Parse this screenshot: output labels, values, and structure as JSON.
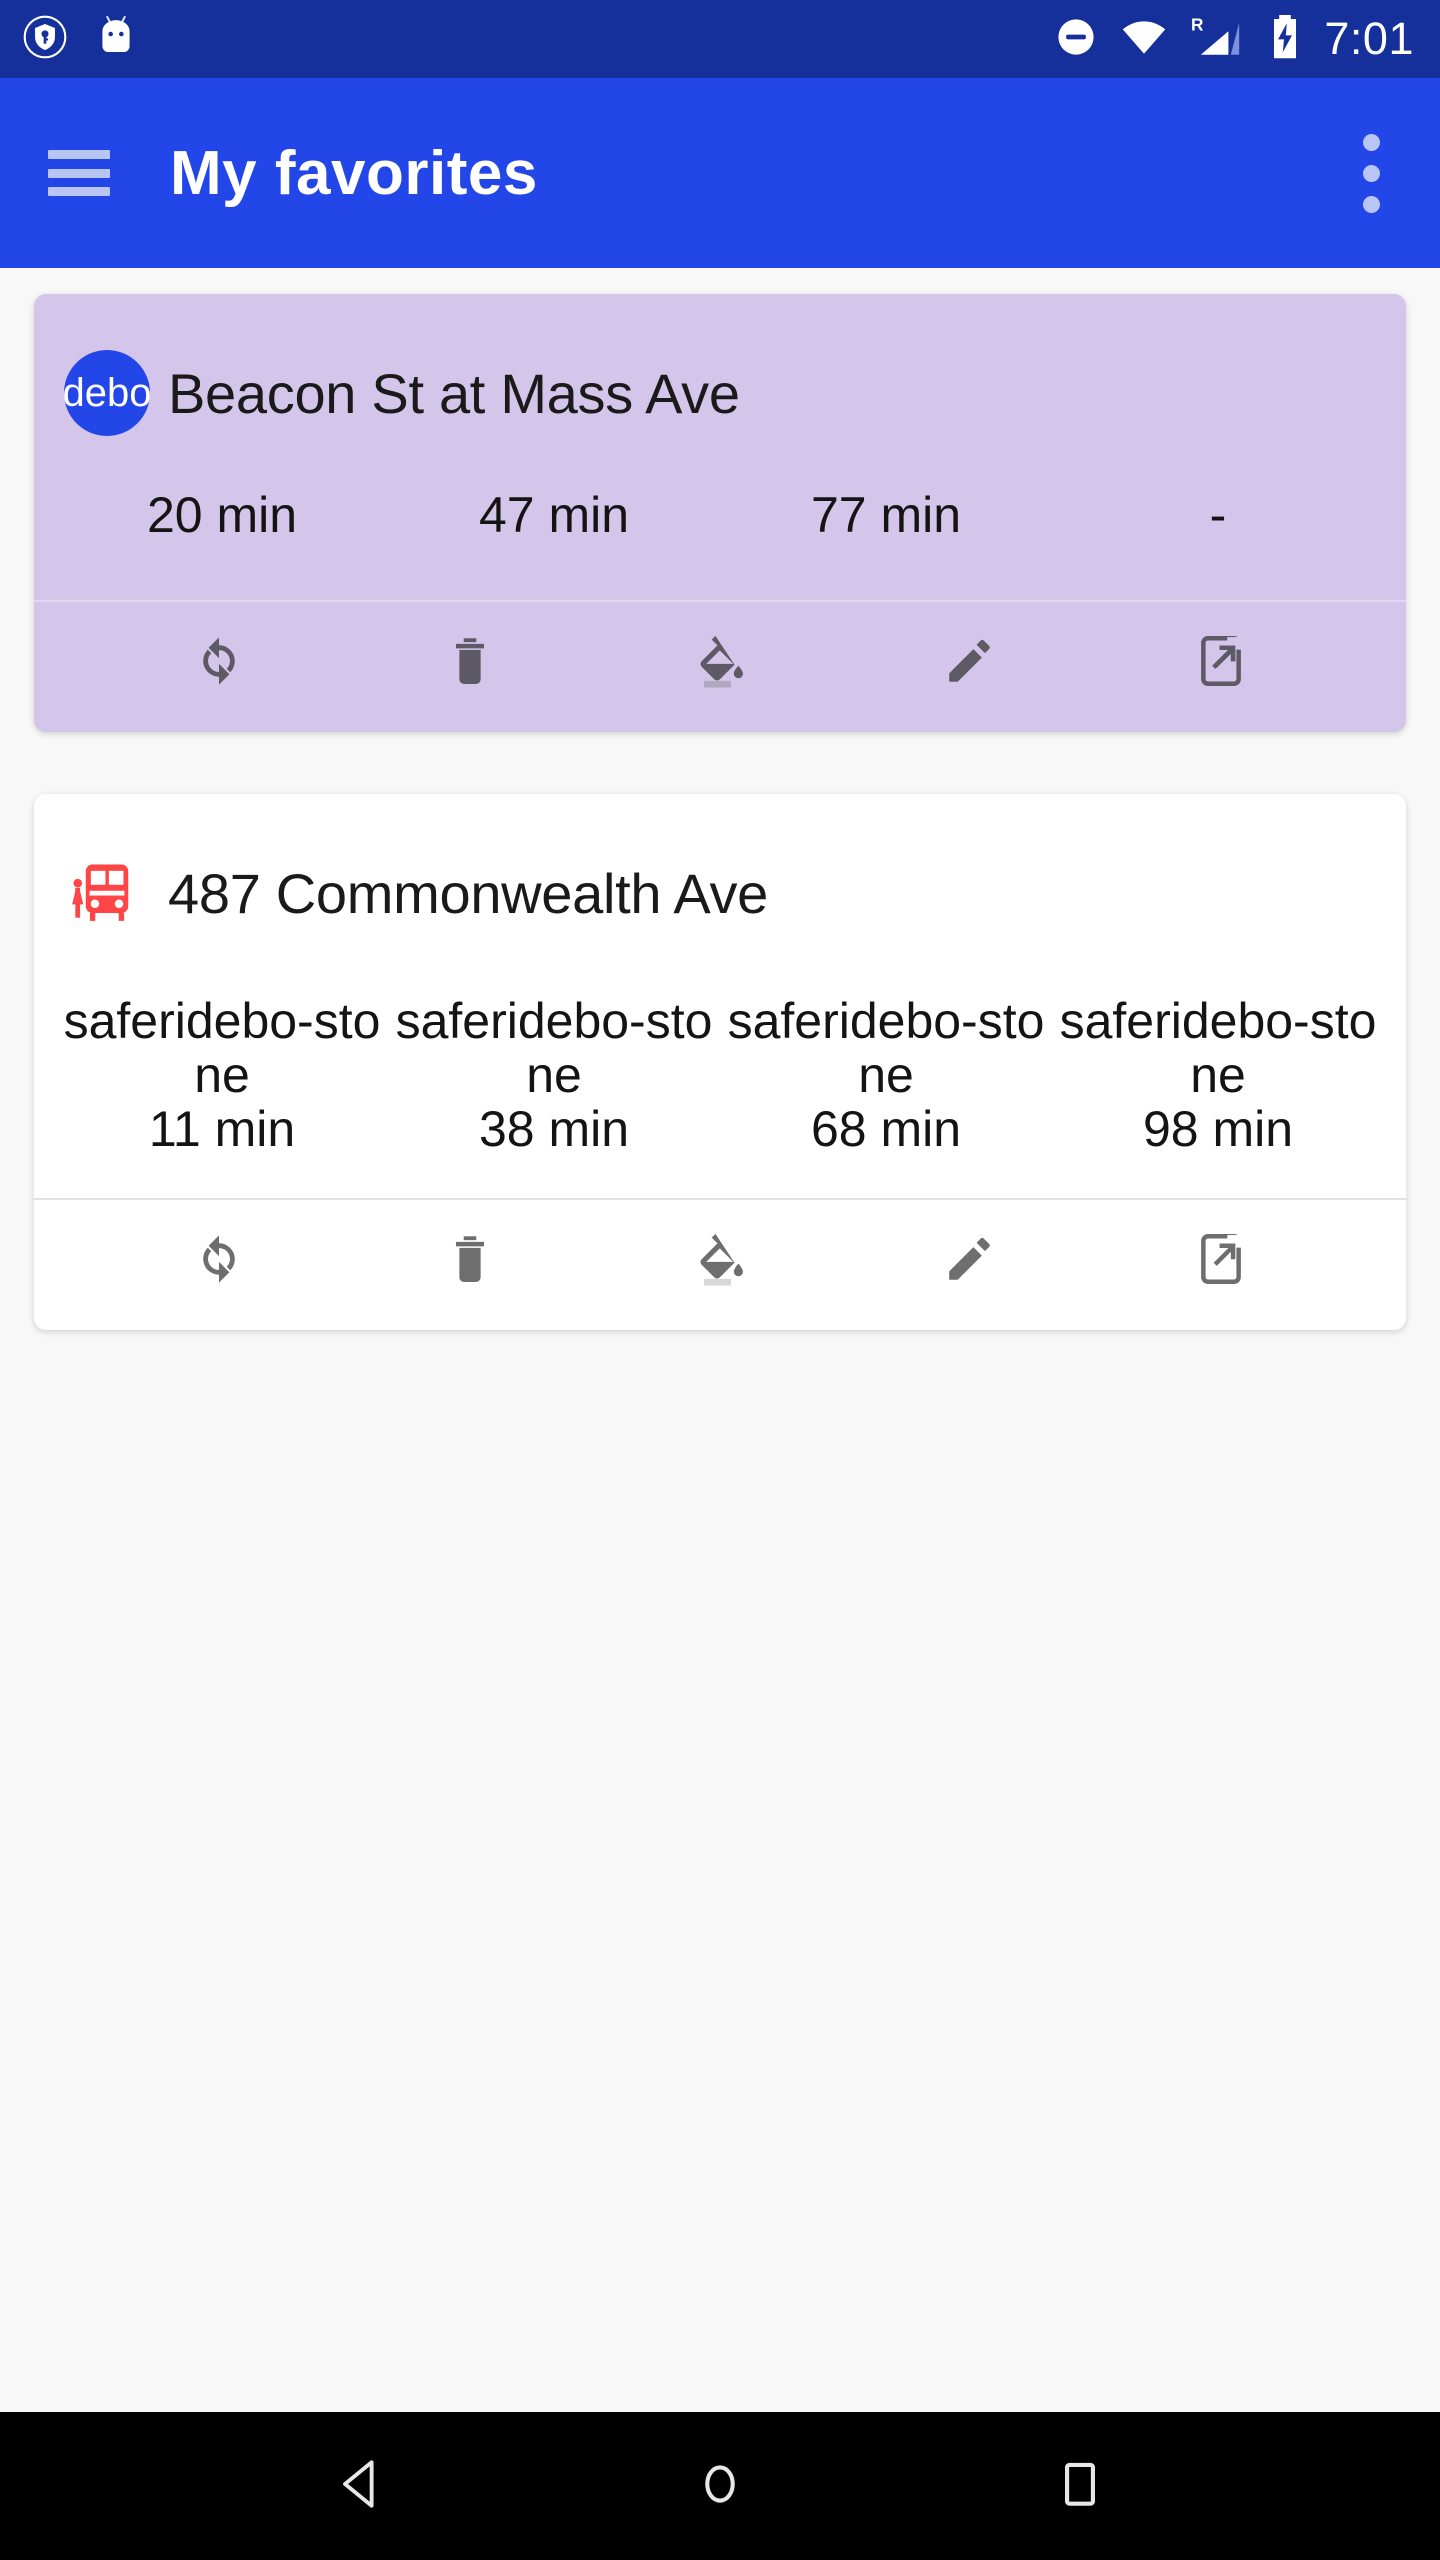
{
  "status_bar": {
    "background_color": "#16309b",
    "left_icons": [
      "vpn-key-shield-icon",
      "android-head-icon"
    ],
    "right_icons": [
      "do-not-disturb-icon",
      "wifi-icon",
      "roaming-signal-icon",
      "battery-charging-icon"
    ],
    "roaming_label": "R",
    "clock": "7:01"
  },
  "app_bar": {
    "background_color": "#2346e8",
    "menu_icon": "hamburger-menu-icon",
    "title": "My favorites",
    "overflow_icon": "more-vert-icon"
  },
  "action_icons": [
    {
      "name": "refresh-icon",
      "label": "Refresh"
    },
    {
      "name": "delete-icon",
      "label": "Delete"
    },
    {
      "name": "format-color-fill-icon",
      "label": "Change color"
    },
    {
      "name": "edit-icon",
      "label": "Edit"
    },
    {
      "name": "open-in-new-icon",
      "label": "Open"
    }
  ],
  "cards": [
    {
      "id": "beacon-st-at-mass-ave",
      "style": "lavender",
      "background_color": "#d4c6ea",
      "badge": {
        "type": "route-circle-badge",
        "text": "saferidebo-stone",
        "visible_text": "debo",
        "color": "#2346e8"
      },
      "title": "Beacon St at Mass Ave",
      "predictions": [
        {
          "route": "",
          "time": "20 min"
        },
        {
          "route": "",
          "time": "47 min"
        },
        {
          "route": "",
          "time": "77 min"
        },
        {
          "route": "",
          "time": "-"
        }
      ]
    },
    {
      "id": "487-commonwealth-ave",
      "style": "white",
      "background_color": "#ffffff",
      "badge": {
        "type": "bus-stop-emoji",
        "text": "🚏",
        "color": "#ff4545"
      },
      "title": "487 Commonwealth Ave",
      "predictions": [
        {
          "route": "saferidebo-stone",
          "time": "11 min"
        },
        {
          "route": "saferidebo-stone",
          "time": "38 min"
        },
        {
          "route": "saferidebo-stone",
          "time": "68 min"
        },
        {
          "route": "saferidebo-stone",
          "time": "98 min"
        }
      ]
    }
  ],
  "nav_bar": {
    "background_color": "#000000",
    "buttons": [
      {
        "name": "back-button",
        "icon": "triangle-back-icon"
      },
      {
        "name": "home-button",
        "icon": "circle-home-icon"
      },
      {
        "name": "recents-button",
        "icon": "square-recents-icon"
      }
    ]
  }
}
